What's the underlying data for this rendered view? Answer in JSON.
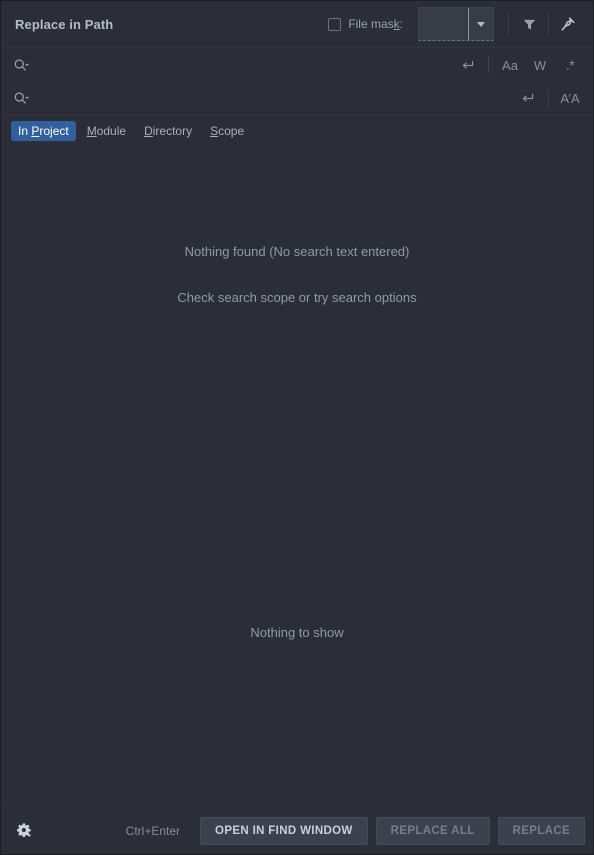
{
  "header": {
    "title": "Replace in Path",
    "file_mask_label_pre": "File mas",
    "file_mask_label_mnemonic": "k",
    "file_mask_label_post": ":",
    "file_mask_checked": false,
    "file_mask_value": "",
    "filter_icon": "filter-icon",
    "pin_icon": "pin-icon"
  },
  "search": {
    "find_icon": "search-history-icon",
    "find_value": "",
    "find_placeholder": "",
    "replace_icon": "search-history-icon",
    "replace_value": "",
    "replace_placeholder": "",
    "options_find": [
      {
        "name": "multiline-toggle",
        "glyph": "↵"
      },
      {
        "name": "match-case-toggle",
        "glyph": "Aa"
      },
      {
        "name": "words-toggle",
        "glyph": "W"
      },
      {
        "name": "regex-toggle",
        "glyph": ".*"
      }
    ],
    "options_replace": [
      {
        "name": "multiline-toggle",
        "glyph": "↵"
      },
      {
        "name": "preserve-case-toggle",
        "glyph": "A’A"
      }
    ]
  },
  "scope": {
    "tabs": [
      {
        "pre": "In ",
        "mnemonic": "P",
        "post": "roject",
        "selected": true
      },
      {
        "pre": "",
        "mnemonic": "M",
        "post": "odule",
        "selected": false
      },
      {
        "pre": "",
        "mnemonic": "D",
        "post": "irectory",
        "selected": false
      },
      {
        "pre": "",
        "mnemonic": "S",
        "post": "cope",
        "selected": false
      }
    ]
  },
  "results": {
    "message_primary": "Nothing found (No search text entered)",
    "message_secondary": "Check search scope or try search options"
  },
  "preview": {
    "message": "Nothing to show"
  },
  "bottom": {
    "settings_icon": "gear-icon",
    "shortcut": "Ctrl+Enter",
    "open_in_find_window": "OPEN IN FIND WINDOW",
    "replace_all": "REPLACE ALL",
    "replace": "REPLACE"
  },
  "colors": {
    "background": "#2b2e37",
    "accent_selected_tab": "#31609e",
    "text_primary": "#b6bcc7",
    "text_secondary": "#9099a8",
    "text_disabled": "#767d8c",
    "button_face": "#3c414e",
    "divider": "#32353f"
  }
}
